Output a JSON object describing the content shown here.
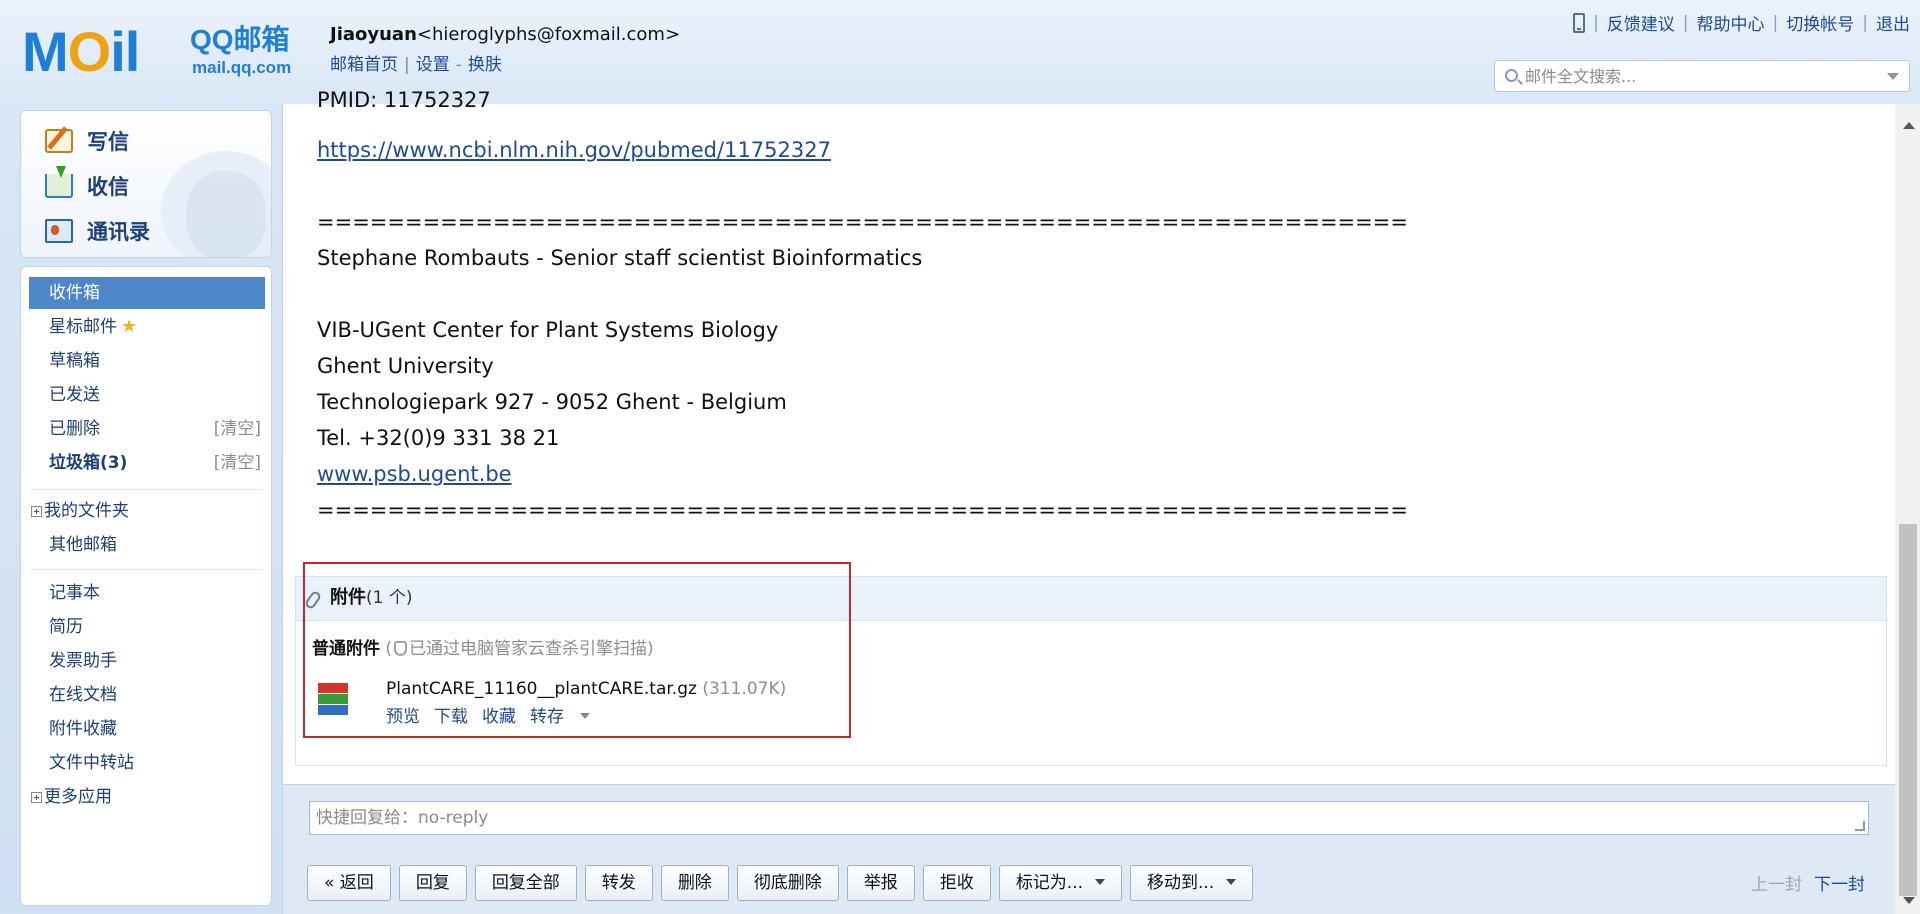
{
  "logo": {
    "moil_m": "M",
    "moil_o": "O",
    "moil_il": "il",
    "qq": "QQ邮箱",
    "domain": "mail.qq.com"
  },
  "account": {
    "name": "Jiaoyuan",
    "email": "<hieroglyphs@foxmail.com>",
    "links": [
      "邮箱首页",
      "设置",
      "换肤"
    ]
  },
  "top_links": [
    "反馈建议",
    "帮助中心",
    "切换帐号",
    "退出"
  ],
  "search": {
    "placeholder": "邮件全文搜索..."
  },
  "actions": {
    "compose": "写信",
    "inbox": "收信",
    "contacts": "通讯录"
  },
  "folders": {
    "inbox": "收件箱",
    "starred": "星标邮件",
    "drafts": "草稿箱",
    "sent": "已发送",
    "deleted": "已删除",
    "spam": "垃圾箱(3)",
    "clear": "[清空]",
    "my_folders": "我的文件夹",
    "other_mailboxes": "其他邮箱",
    "notepad": "记事本",
    "resume": "简历",
    "invoice": "发票助手",
    "online_docs": "在线文档",
    "attachment_fav": "附件收藏",
    "file_transfer": "文件中转站",
    "more_apps": "更多应用"
  },
  "email_body": {
    "pmid_partial": "PMID: 11752327",
    "pubmed_link": "https://www.ncbi.nlm.nih.gov/pubmed/11752327",
    "divider": "==============================================================",
    "signature_name": "Stephane Rombauts - Senior staff scientist Bioinformatics",
    "org": "VIB-UGent Center for Plant Systems Biology",
    "university": "Ghent University",
    "address": "Technologiepark 927 - 9052 Ghent - Belgium",
    "tel": "Tel. +32(0)9 331 38 21",
    "website": "www.psb.ugent.be"
  },
  "attachments": {
    "title": "附件",
    "count": "(1 个)",
    "section": "普通附件",
    "scan_note": "已通过电脑管家云查杀引擎扫描)",
    "scan_open": "(",
    "file": {
      "name": "PlantCARE_11160__plantCARE.tar.gz",
      "size": "(311.07K)"
    },
    "actions": {
      "preview": "预览",
      "download": "下载",
      "favorite": "收藏",
      "save_to": "转存"
    }
  },
  "quick_reply": {
    "placeholder": "快捷回复给：no-reply"
  },
  "toolbar": {
    "back": "« 返回",
    "reply": "回复",
    "reply_all": "回复全部",
    "forward": "转发",
    "delete": "删除",
    "delete_perm": "彻底删除",
    "report": "举报",
    "reject": "拒收",
    "mark_as": "标记为...",
    "move_to": "移动到..."
  },
  "pager": {
    "prev": "上一封",
    "next": "下一封"
  },
  "colors": {
    "accent": "#4d86c9",
    "link": "#1e4a96",
    "highlight": "#c0282a",
    "background": "#d8e6f5"
  }
}
